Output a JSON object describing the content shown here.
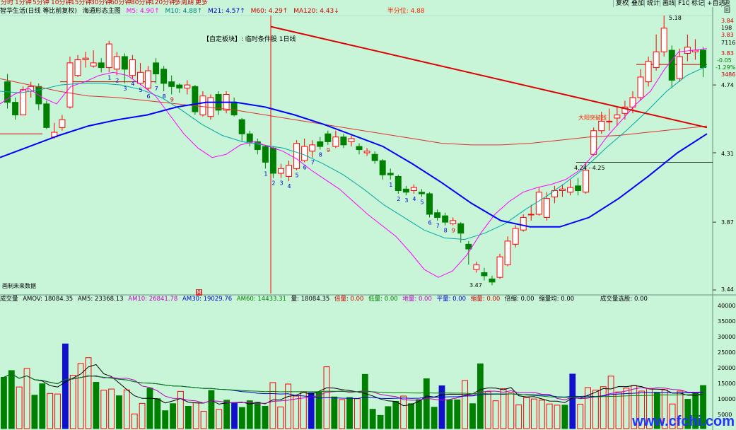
{
  "toolbar": {
    "periods": [
      "分时",
      "1分钟",
      "5分钟",
      "10分钟",
      "15分钟",
      "30分钟",
      "60分钟",
      "80分钟",
      "120分钟",
      "多周期",
      "更多"
    ],
    "right_buttons": [
      "复权",
      "叠加",
      "统计",
      "画线",
      "F10",
      "标记",
      "+自选",
      "返回"
    ]
  },
  "infobar": {
    "title": "智华生活(日线 等比前复权)",
    "indicator": "海通形态主图",
    "ma5": "M5: 4.90↑",
    "ma10": "M10: 4.88↑",
    "ma21": "M21: 4.57↑",
    "ma60": "M60: 4.29↑",
    "ma120": "MA120: 4.43↓",
    "half_cut": "半分位: 4.88"
  },
  "annotations": {
    "custom_block": "【自定板块】: 临时条件股 1日线",
    "high_label": "5.18",
    "low_label": "3.47",
    "break_label": "大阳突破钱",
    "range_label": "4.24 - 4.25",
    "future_data": "画制未来数据",
    "small_icon": "M"
  },
  "right_axis": {
    "ticks_main": [
      "4.74",
      "4.31",
      "3.87",
      "3.44"
    ],
    "info": [
      "3.84",
      "198",
      "3.83",
      "7116",
      "3.83",
      "-0.05",
      "-1.29%",
      "3486"
    ]
  },
  "volume_bar": {
    "label": "成交量",
    "amov": "AMOV: 18084.35",
    "am5": "AM5: 23368.13",
    "am10": "AM10: 26841.78",
    "am30": "AM30: 19029.76",
    "am60": "AM60: 14433.31",
    "liang": "量: 18084.35",
    "items": [
      "倍量: 0.00",
      "低量: 0.00",
      "地量: 0.00",
      "平量: 0.00",
      "缩量: 0.00",
      "倍缩: 0.00",
      "缩量均: 0.00",
      "成交量选股: 0.00"
    ],
    "ticks": [
      "40000",
      "35000",
      "30000",
      "25000",
      "20000",
      "15000",
      "10000",
      "5000"
    ]
  },
  "watermark": "www.cfchi.com",
  "colors": {
    "background": "#c8f5d8",
    "up_candle": "#ff0000",
    "down_candle": "#008000",
    "ma_blue": "#0000ff",
    "ma_red": "#dd0000",
    "ma_magenta": "#ff00ff",
    "ma_cyan": "#00a8a8"
  },
  "chart_data": {
    "type": "candlestick",
    "ylim": [
      3.44,
      5.18
    ],
    "candles": [
      {
        "o": 4.76,
        "c": 4.63,
        "h": 4.81,
        "l": 4.59
      },
      {
        "o": 4.63,
        "c": 4.55,
        "h": 4.66,
        "l": 4.52
      },
      {
        "o": 4.55,
        "c": 4.71,
        "h": 4.73,
        "l": 4.55
      },
      {
        "o": 4.7,
        "c": 4.73,
        "h": 4.76,
        "l": 4.66
      },
      {
        "o": 4.73,
        "c": 4.62,
        "h": 4.75,
        "l": 4.58
      },
      {
        "o": 4.62,
        "c": 4.47,
        "h": 4.64,
        "l": 4.46
      },
      {
        "o": 4.41,
        "c": 4.44,
        "h": 4.5,
        "l": 4.4
      },
      {
        "o": 4.47,
        "c": 4.52,
        "h": 4.55,
        "l": 4.45
      },
      {
        "o": 4.6,
        "c": 4.88,
        "h": 4.92,
        "l": 4.59
      },
      {
        "o": 4.8,
        "c": 4.9,
        "h": 4.93,
        "l": 4.79
      },
      {
        "o": 4.9,
        "c": 4.91,
        "h": 4.95,
        "l": 4.85
      },
      {
        "o": 4.86,
        "c": 4.88,
        "h": 4.96,
        "l": 4.85
      },
      {
        "o": 4.88,
        "c": 4.85,
        "h": 4.91,
        "l": 4.82
      },
      {
        "o": 4.85,
        "c": 5.0,
        "h": 5.02,
        "l": 4.82
      },
      {
        "o": 4.84,
        "c": 4.92,
        "h": 4.95,
        "l": 4.8
      },
      {
        "o": 4.92,
        "c": 4.84,
        "h": 4.94,
        "l": 4.75
      },
      {
        "o": 4.8,
        "c": 4.9,
        "h": 4.93,
        "l": 4.78
      },
      {
        "o": 4.75,
        "c": 4.82,
        "h": 4.88,
        "l": 4.74
      },
      {
        "o": 4.72,
        "c": 4.83,
        "h": 4.86,
        "l": 4.7
      },
      {
        "o": 4.88,
        "c": 4.81,
        "h": 4.91,
        "l": 4.75
      },
      {
        "o": 4.84,
        "c": 4.75,
        "h": 4.86,
        "l": 4.7
      },
      {
        "o": 4.76,
        "c": 4.73,
        "h": 4.8,
        "l": 4.68
      },
      {
        "o": 4.74,
        "c": 4.72,
        "h": 4.75,
        "l": 4.69
      },
      {
        "o": 4.72,
        "c": 4.74,
        "h": 4.77,
        "l": 4.68
      },
      {
        "o": 4.73,
        "c": 4.57,
        "h": 4.74,
        "l": 4.55
      },
      {
        "o": 4.55,
        "c": 4.67,
        "h": 4.7,
        "l": 4.54
      },
      {
        "o": 4.54,
        "c": 4.66,
        "h": 4.68,
        "l": 4.52
      },
      {
        "o": 4.68,
        "c": 4.58,
        "h": 4.7,
        "l": 4.55
      },
      {
        "o": 4.58,
        "c": 4.68,
        "h": 4.7,
        "l": 4.56
      },
      {
        "o": 4.63,
        "c": 4.55,
        "h": 4.66,
        "l": 4.54
      },
      {
        "o": 4.52,
        "c": 4.43,
        "h": 4.53,
        "l": 4.38
      },
      {
        "o": 4.43,
        "c": 4.38,
        "h": 4.45,
        "l": 4.35
      },
      {
        "o": 4.38,
        "c": 4.33,
        "h": 4.4,
        "l": 4.3
      },
      {
        "o": 4.35,
        "c": 4.25,
        "h": 4.36,
        "l": 4.21
      },
      {
        "o": 4.34,
        "c": 4.18,
        "h": 4.35,
        "l": 4.15
      },
      {
        "o": 4.18,
        "c": 4.21,
        "h": 4.24,
        "l": 4.15
      },
      {
        "o": 4.16,
        "c": 4.23,
        "h": 4.26,
        "l": 4.13
      },
      {
        "o": 4.21,
        "c": 4.37,
        "h": 4.39,
        "l": 4.2
      },
      {
        "o": 4.26,
        "c": 4.35,
        "h": 4.4,
        "l": 4.25
      },
      {
        "o": 4.32,
        "c": 4.36,
        "h": 4.39,
        "l": 4.28
      },
      {
        "o": 4.38,
        "c": 4.35,
        "h": 4.41,
        "l": 4.33
      },
      {
        "o": 4.43,
        "c": 4.38,
        "h": 4.45,
        "l": 4.36
      },
      {
        "o": 4.35,
        "c": 4.41,
        "h": 4.45,
        "l": 4.34
      },
      {
        "o": 4.41,
        "c": 4.36,
        "h": 4.43,
        "l": 4.34
      },
      {
        "o": 4.38,
        "c": 4.4,
        "h": 4.42,
        "l": 4.35
      },
      {
        "o": 4.35,
        "c": 4.33,
        "h": 4.37,
        "l": 4.3
      },
      {
        "o": 4.31,
        "c": 4.32,
        "h": 4.34,
        "l": 4.29
      },
      {
        "o": 4.3,
        "c": 4.26,
        "h": 4.32,
        "l": 4.24
      },
      {
        "o": 4.26,
        "c": 4.17,
        "h": 4.27,
        "l": 4.14
      },
      {
        "o": 4.18,
        "c": 4.17,
        "h": 4.21,
        "l": 4.14
      },
      {
        "o": 4.16,
        "c": 4.07,
        "h": 4.17,
        "l": 4.05
      },
      {
        "o": 4.08,
        "c": 4.06,
        "h": 4.1,
        "l": 4.04
      },
      {
        "o": 4.07,
        "c": 4.09,
        "h": 4.11,
        "l": 4.05
      },
      {
        "o": 4.06,
        "c": 4.05,
        "h": 4.08,
        "l": 4.03
      },
      {
        "o": 4.05,
        "c": 3.92,
        "h": 4.06,
        "l": 3.9
      },
      {
        "o": 3.93,
        "c": 3.9,
        "h": 3.95,
        "l": 3.88
      },
      {
        "o": 3.91,
        "c": 3.87,
        "h": 3.93,
        "l": 3.85
      },
      {
        "o": 3.86,
        "c": 3.88,
        "h": 3.9,
        "l": 3.85
      },
      {
        "o": 3.86,
        "c": 3.8,
        "h": 3.87,
        "l": 3.74
      },
      {
        "o": 3.73,
        "c": 3.7,
        "h": 3.75,
        "l": 3.6
      },
      {
        "o": 3.57,
        "c": 3.6,
        "h": 3.62,
        "l": 3.55
      },
      {
        "o": 3.55,
        "c": 3.53,
        "h": 3.58,
        "l": 3.5
      },
      {
        "o": 3.51,
        "c": 3.49,
        "h": 3.53,
        "l": 3.47
      },
      {
        "o": 3.52,
        "c": 3.65,
        "h": 3.67,
        "l": 3.51
      },
      {
        "o": 3.6,
        "c": 3.75,
        "h": 3.78,
        "l": 3.59
      },
      {
        "o": 3.73,
        "c": 3.83,
        "h": 3.85,
        "l": 3.71
      },
      {
        "o": 3.82,
        "c": 3.9,
        "h": 3.92,
        "l": 3.81
      },
      {
        "o": 3.92,
        "c": 3.92,
        "h": 3.98,
        "l": 3.88
      },
      {
        "o": 3.92,
        "c": 4.06,
        "h": 4.09,
        "l": 3.91
      },
      {
        "o": 3.9,
        "c": 4.02,
        "h": 4.06,
        "l": 3.88
      },
      {
        "o": 4.03,
        "c": 4.07,
        "h": 4.1,
        "l": 3.99
      },
      {
        "o": 4.07,
        "c": 4.08,
        "h": 4.11,
        "l": 4.03
      },
      {
        "o": 4.06,
        "c": 4.09,
        "h": 4.14,
        "l": 4.04
      },
      {
        "o": 4.1,
        "c": 4.07,
        "h": 4.15,
        "l": 4.04
      },
      {
        "o": 4.06,
        "c": 4.2,
        "h": 4.24,
        "l": 4.05
      },
      {
        "o": 4.3,
        "c": 4.45,
        "h": 4.47,
        "l": 4.29
      },
      {
        "o": 4.45,
        "c": 4.51,
        "h": 4.57,
        "l": 4.43
      },
      {
        "o": 4.51,
        "c": 4.51,
        "h": 4.59,
        "l": 4.45
      },
      {
        "o": 4.53,
        "c": 4.55,
        "h": 4.6,
        "l": 4.48
      },
      {
        "o": 4.56,
        "c": 4.6,
        "h": 4.64,
        "l": 4.52
      },
      {
        "o": 4.6,
        "c": 4.66,
        "h": 4.7,
        "l": 4.56
      },
      {
        "o": 4.66,
        "c": 4.79,
        "h": 4.84,
        "l": 4.64
      },
      {
        "o": 4.76,
        "c": 4.89,
        "h": 4.92,
        "l": 4.73
      },
      {
        "o": 4.85,
        "c": 4.95,
        "h": 5.06,
        "l": 4.83
      },
      {
        "o": 4.95,
        "c": 5.1,
        "h": 5.18,
        "l": 4.92
      },
      {
        "o": 4.96,
        "c": 4.77,
        "h": 4.99,
        "l": 4.72
      },
      {
        "o": 4.78,
        "c": 4.92,
        "h": 4.97,
        "l": 4.76
      },
      {
        "o": 4.94,
        "c": 4.98,
        "h": 5.06,
        "l": 4.89
      },
      {
        "o": 4.95,
        "c": 4.96,
        "h": 5.03,
        "l": 4.9
      },
      {
        "o": 4.96,
        "c": 4.85,
        "h": 4.98,
        "l": 4.79
      }
    ],
    "ma_blue": [
      4.28,
      4.35,
      4.42,
      4.48,
      4.52,
      4.55,
      4.6,
      4.63,
      4.63,
      4.6,
      4.55,
      4.49,
      4.42,
      4.35,
      4.24,
      4.12,
      3.99,
      3.88,
      3.84,
      3.84,
      3.9,
      4.02,
      4.16,
      4.31,
      4.43
    ],
    "ma_red": [
      4.78,
      4.74,
      4.7,
      4.67,
      4.66,
      4.64,
      4.62,
      4.6,
      4.58,
      4.55,
      4.52,
      4.49,
      4.46,
      4.43,
      4.4,
      4.37,
      4.36,
      4.36,
      4.37,
      4.39,
      4.41,
      4.42,
      4.44,
      4.46,
      4.48
    ],
    "ma_red_top_x": [
      383,
      1000
    ],
    "ma_red_top": [
      5.11,
      4.47
    ],
    "ma_magenta": [
      4.62,
      4.68,
      4.72,
      4.66,
      4.62,
      4.73,
      4.76,
      4.8,
      4.82,
      4.8,
      4.74,
      4.67,
      4.55,
      4.43,
      4.34,
      4.28,
      4.3,
      4.36,
      4.38,
      4.35,
      4.32,
      4.27,
      4.2,
      4.14,
      4.08,
      4.0,
      3.92,
      3.85,
      3.78,
      3.68,
      3.57,
      3.52,
      3.56,
      3.66,
      3.8,
      3.92,
      4.0,
      4.06,
      4.09,
      4.11,
      4.14,
      4.2,
      4.3,
      4.42,
      4.52,
      4.62,
      4.7,
      4.84,
      4.95,
      4.96,
      4.97
    ],
    "ma_cyan": [
      4.7,
      4.69,
      4.71,
      4.74,
      4.75,
      4.75,
      4.74,
      4.71,
      4.66,
      4.58,
      4.49,
      4.42,
      4.38,
      4.36,
      4.34,
      4.3,
      4.24,
      4.17,
      4.08,
      3.98,
      3.9,
      3.82,
      3.77,
      3.76,
      3.8,
      3.86,
      3.95,
      4.03,
      4.12,
      4.22,
      4.34,
      4.45,
      4.57,
      4.7,
      4.8,
      4.86
    ],
    "seq_labels": [
      {
        "t": "1",
        "i": 13
      },
      {
        "t": "2",
        "i": 14
      },
      {
        "t": "3",
        "i": 15
      },
      {
        "t": "4",
        "i": 16
      },
      {
        "t": "5",
        "i": 17
      },
      {
        "t": "6",
        "i": 18
      },
      {
        "t": "7",
        "i": 19
      },
      {
        "t": "8",
        "i": 20
      },
      {
        "t": "9",
        "i": 21
      },
      {
        "t": "1",
        "i": 33
      },
      {
        "t": "2",
        "i": 34
      },
      {
        "t": "3",
        "i": 35
      },
      {
        "t": "4",
        "i": 36
      },
      {
        "t": "5",
        "i": 37
      },
      {
        "t": "6",
        "i": 38
      },
      {
        "t": "7",
        "i": 39
      },
      {
        "t": "8",
        "i": 40
      },
      {
        "t": "9",
        "i": 41
      },
      {
        "t": "1",
        "i": 49
      },
      {
        "t": "2",
        "i": 50
      },
      {
        "t": "3",
        "i": 51
      },
      {
        "t": "4",
        "i": 52
      },
      {
        "t": "5",
        "i": 53
      },
      {
        "t": "6",
        "i": 54
      },
      {
        "t": "7",
        "i": 55
      },
      {
        "t": "8",
        "i": 56
      },
      {
        "t": "9",
        "i": 57
      }
    ],
    "volumes": [
      17500,
      19800,
      14200,
      20500,
      11400,
      15300,
      12000,
      11800,
      28900,
      18200,
      22200,
      24200,
      15800,
      13100,
      13500,
      11200,
      13200,
      5000,
      8600,
      13800,
      10200,
      6100,
      8500,
      12700,
      7600,
      8800,
      5900,
      13000,
      6500,
      9700,
      8900,
      7200,
      9500,
      9000,
      7600,
      15700,
      7400,
      15200,
      11100,
      12600,
      12200,
      12500,
      21100,
      10800,
      9900,
      10600,
      10200,
      18500,
      6600,
      4500,
      7500,
      9300,
      11100,
      8500,
      9900,
      17000,
      7300,
      14600,
      9800,
      9800,
      16400,
      8500,
      22100,
      12600,
      9500,
      13600,
      12200,
      8100,
      10600,
      10100,
      9700,
      8400,
      8000,
      8000,
      18600,
      8300,
      14000,
      13100,
      14300,
      17900,
      12500,
      13800,
      14700,
      12800,
      13700,
      12400,
      13200,
      8400,
      12800,
      10000,
      12400,
      14700
    ],
    "vol_ylim": [
      0,
      42000
    ]
  }
}
